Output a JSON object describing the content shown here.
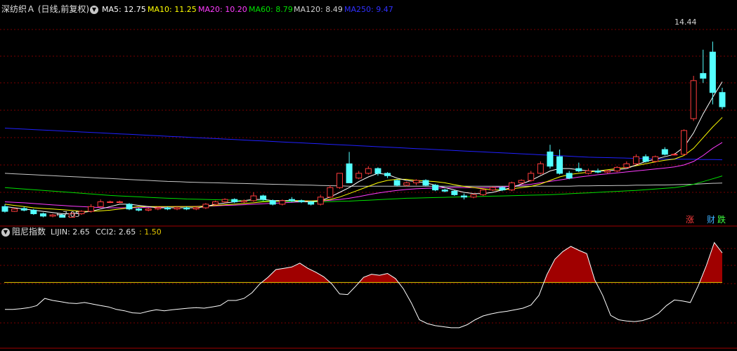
{
  "main_panel": {
    "stock_name": "深纺织Ａ",
    "period_mode": "(日线,前复权)",
    "ma5_label": "MA5: 12.75",
    "ma10_label": "MA10: 11.25",
    "ma20_label": "MA20: 10.20",
    "ma60_label": "MA60: 8.79",
    "ma120_label": "MA120: 8.49",
    "ma250_label": "MA250: 9.47",
    "high_annotation": "14.44",
    "low_annotation": "7.05",
    "side_tags": [
      "涨",
      "财",
      "跌"
    ]
  },
  "sub_panel": {
    "indicator_name": "阻尼指数",
    "lijin_label": "LIJIN: 2.65",
    "cci2_label": "CCI2: 2.65",
    "extra_label": ": 1.50"
  },
  "colors": {
    "background": "#000000",
    "grid": "#7a0000",
    "up": "#ff3c3c",
    "down": "#54ffff",
    "ma5": "#ffffff",
    "ma10": "#ffff00",
    "ma20": "#ff3cff",
    "ma60": "#00e000",
    "ma120": "#c8c8c8",
    "ma250": "#2020ff",
    "fill": "#a00000",
    "threshold": "#e6c800"
  },
  "chart_data": [
    {
      "type": "candlestick",
      "title": "深纺织Ａ (日线,前复权)",
      "ylim": [
        6.8,
        15.6
      ],
      "candles": [
        [
          7.5,
          7.3,
          7.6,
          7.25
        ],
        [
          7.3,
          7.4,
          7.45,
          7.28
        ],
        [
          7.42,
          7.35,
          7.5,
          7.3
        ],
        [
          7.35,
          7.2,
          7.4,
          7.15
        ],
        [
          7.2,
          7.1,
          7.25,
          7.05
        ],
        [
          7.1,
          7.15,
          7.2,
          7.05
        ],
        [
          7.15,
          7.05,
          7.2,
          7.05
        ],
        [
          7.05,
          7.2,
          7.3,
          7.05
        ],
        [
          7.2,
          7.3,
          7.35,
          7.15
        ],
        [
          7.3,
          7.5,
          7.6,
          7.25
        ],
        [
          7.5,
          7.7,
          7.8,
          7.45
        ],
        [
          7.7,
          7.7,
          7.75,
          7.65
        ],
        [
          7.7,
          7.7,
          7.75,
          7.65
        ],
        [
          7.6,
          7.4,
          7.65,
          7.35
        ],
        [
          7.4,
          7.35,
          7.45,
          7.3
        ],
        [
          7.35,
          7.4,
          7.45,
          7.3
        ],
        [
          7.4,
          7.45,
          7.5,
          7.35
        ],
        [
          7.45,
          7.4,
          7.5,
          7.35
        ],
        [
          7.4,
          7.45,
          7.5,
          7.35
        ],
        [
          7.45,
          7.4,
          7.5,
          7.35
        ],
        [
          7.4,
          7.45,
          7.5,
          7.35
        ],
        [
          7.45,
          7.6,
          7.65,
          7.4
        ],
        [
          7.6,
          7.7,
          7.75,
          7.55
        ],
        [
          7.7,
          7.8,
          7.85,
          7.65
        ],
        [
          7.8,
          7.7,
          7.85,
          7.65
        ],
        [
          7.7,
          7.75,
          7.8,
          7.65
        ],
        [
          7.75,
          7.95,
          8.1,
          7.7
        ],
        [
          7.95,
          7.8,
          8.0,
          7.75
        ],
        [
          7.75,
          7.6,
          7.8,
          7.55
        ],
        [
          7.6,
          7.75,
          7.8,
          7.55
        ],
        [
          7.8,
          7.75,
          7.9,
          7.7
        ],
        [
          7.75,
          7.7,
          7.8,
          7.65
        ],
        [
          7.7,
          7.6,
          7.75,
          7.55
        ],
        [
          7.6,
          7.9,
          8.0,
          7.55
        ],
        [
          7.9,
          8.3,
          8.4,
          7.85
        ],
        [
          8.3,
          8.9,
          8.9,
          8.25
        ],
        [
          9.3,
          8.5,
          9.8,
          8.5
        ],
        [
          8.7,
          8.9,
          9.0,
          8.65
        ],
        [
          8.9,
          9.1,
          9.2,
          8.85
        ],
        [
          9.1,
          8.9,
          9.15,
          8.8
        ],
        [
          8.9,
          8.8,
          8.95,
          8.7
        ],
        [
          8.6,
          8.4,
          8.65,
          8.35
        ],
        [
          8.4,
          8.5,
          8.55,
          8.35
        ],
        [
          8.5,
          8.6,
          8.65,
          8.4
        ],
        [
          8.6,
          8.4,
          8.65,
          8.35
        ],
        [
          8.4,
          8.2,
          8.45,
          8.15
        ],
        [
          8.2,
          8.15,
          8.25,
          8.1
        ],
        [
          8.15,
          8.0,
          8.2,
          7.95
        ],
        [
          7.95,
          7.9,
          8.05,
          7.8
        ],
        [
          7.9,
          8.0,
          8.05,
          7.85
        ],
        [
          8.0,
          8.2,
          8.25,
          7.95
        ],
        [
          8.2,
          8.3,
          8.35,
          8.15
        ],
        [
          8.3,
          8.2,
          8.35,
          8.15
        ],
        [
          8.2,
          8.5,
          8.55,
          8.15
        ],
        [
          8.5,
          8.6,
          8.65,
          8.45
        ],
        [
          8.6,
          8.9,
          9.0,
          8.55
        ],
        [
          8.9,
          9.3,
          9.4,
          8.85
        ],
        [
          9.8,
          9.2,
          10.1,
          9.1
        ],
        [
          9.6,
          8.9,
          9.9,
          8.85
        ],
        [
          8.9,
          8.7,
          9.0,
          8.65
        ],
        [
          9.1,
          9.0,
          9.35,
          8.95
        ],
        [
          8.9,
          9.0,
          9.1,
          8.85
        ],
        [
          9.0,
          8.95,
          9.1,
          8.9
        ],
        [
          8.95,
          9.0,
          9.05,
          8.9
        ],
        [
          9.0,
          9.15,
          9.2,
          8.95
        ],
        [
          9.15,
          9.3,
          9.4,
          9.1
        ],
        [
          9.3,
          9.6,
          9.7,
          9.25
        ],
        [
          9.6,
          9.4,
          9.7,
          9.35
        ],
        [
          9.4,
          9.6,
          9.65,
          9.35
        ],
        [
          9.9,
          9.7,
          10.0,
          9.65
        ],
        [
          9.7,
          9.7,
          9.75,
          9.65
        ],
        [
          9.7,
          10.7,
          10.75,
          9.65
        ],
        [
          11.2,
          12.8,
          13.0,
          11.1
        ],
        [
          13.1,
          12.9,
          14.1,
          12.7
        ],
        [
          14.0,
          12.3,
          14.44,
          11.8
        ],
        [
          12.3,
          11.7,
          12.5,
          11.6
        ]
      ],
      "ma": {
        "MA5": [
          7.5,
          7.45,
          7.4,
          7.35,
          7.3,
          7.25,
          7.2,
          7.2,
          7.25,
          7.3,
          7.4,
          7.5,
          7.6,
          7.6,
          7.55,
          7.5,
          7.45,
          7.45,
          7.45,
          7.45,
          7.45,
          7.5,
          7.6,
          7.65,
          7.7,
          7.75,
          7.8,
          7.8,
          7.75,
          7.75,
          7.75,
          7.7,
          7.7,
          7.75,
          7.9,
          8.1,
          8.3,
          8.55,
          8.75,
          8.9,
          8.85,
          8.7,
          8.6,
          8.55,
          8.5,
          8.4,
          8.3,
          8.2,
          8.1,
          8.05,
          8.05,
          8.1,
          8.2,
          8.3,
          8.45,
          8.6,
          8.8,
          9.0,
          9.1,
          9.1,
          9.05,
          9.0,
          9.0,
          9.0,
          9.05,
          9.1,
          9.25,
          9.4,
          9.5,
          9.6,
          9.7,
          10.0,
          10.6,
          11.4,
          12.1,
          12.75
        ],
        "MA10": [
          7.6,
          7.55,
          7.5,
          7.45,
          7.42,
          7.4,
          7.37,
          7.34,
          7.3,
          7.3,
          7.32,
          7.35,
          7.4,
          7.45,
          7.5,
          7.5,
          7.5,
          7.5,
          7.5,
          7.5,
          7.5,
          7.52,
          7.55,
          7.58,
          7.6,
          7.63,
          7.66,
          7.7,
          7.72,
          7.74,
          7.75,
          7.75,
          7.74,
          7.75,
          7.8,
          7.9,
          8.05,
          8.2,
          8.35,
          8.5,
          8.6,
          8.65,
          8.65,
          8.6,
          8.58,
          8.55,
          8.5,
          8.42,
          8.35,
          8.3,
          8.25,
          8.2,
          8.2,
          8.25,
          8.3,
          8.35,
          8.45,
          8.6,
          8.75,
          8.85,
          8.9,
          8.95,
          9.0,
          9.05,
          9.1,
          9.15,
          9.22,
          9.3,
          9.38,
          9.45,
          9.5,
          9.65,
          9.95,
          10.4,
          10.85,
          11.25
        ],
        "MA20": [
          7.7,
          7.68,
          7.66,
          7.63,
          7.6,
          7.57,
          7.55,
          7.52,
          7.5,
          7.48,
          7.46,
          7.45,
          7.45,
          7.45,
          7.46,
          7.47,
          7.48,
          7.49,
          7.5,
          7.5,
          7.51,
          7.52,
          7.53,
          7.55,
          7.56,
          7.58,
          7.6,
          7.62,
          7.64,
          7.66,
          7.68,
          7.7,
          7.72,
          7.74,
          7.77,
          7.8,
          7.85,
          7.92,
          8.0,
          8.07,
          8.13,
          8.18,
          8.22,
          8.25,
          8.27,
          8.28,
          8.29,
          8.3,
          8.3,
          8.3,
          8.3,
          8.31,
          8.33,
          8.36,
          8.4,
          8.44,
          8.5,
          8.56,
          8.62,
          8.68,
          8.74,
          8.79,
          8.84,
          8.88,
          8.92,
          8.96,
          9.0,
          9.04,
          9.08,
          9.12,
          9.17,
          9.25,
          9.4,
          9.65,
          9.95,
          10.2
        ],
        "MA60": [
          8.3,
          8.27,
          8.24,
          8.21,
          8.18,
          8.15,
          8.12,
          8.09,
          8.06,
          8.03,
          8.0,
          7.97,
          7.95,
          7.93,
          7.91,
          7.89,
          7.87,
          7.85,
          7.84,
          7.82,
          7.81,
          7.8,
          7.79,
          7.78,
          7.77,
          7.76,
          7.75,
          7.74,
          7.73,
          7.72,
          7.71,
          7.7,
          7.7,
          7.7,
          7.71,
          7.72,
          7.73,
          7.75,
          7.77,
          7.79,
          7.81,
          7.83,
          7.85,
          7.86,
          7.87,
          7.88,
          7.89,
          7.9,
          7.91,
          7.92,
          7.93,
          7.94,
          7.95,
          7.96,
          7.97,
          7.98,
          7.99,
          8.0,
          8.02,
          8.04,
          8.06,
          8.08,
          8.1,
          8.12,
          8.14,
          8.16,
          8.18,
          8.21,
          8.24,
          8.27,
          8.3,
          8.36,
          8.44,
          8.55,
          8.67,
          8.79
        ],
        "MA120": [
          8.9,
          8.88,
          8.86,
          8.84,
          8.82,
          8.8,
          8.78,
          8.76,
          8.74,
          8.72,
          8.7,
          8.68,
          8.66,
          8.64,
          8.62,
          8.6,
          8.58,
          8.56,
          8.55,
          8.53,
          8.52,
          8.51,
          8.5,
          8.49,
          8.48,
          8.47,
          8.46,
          8.45,
          8.44,
          8.43,
          8.42,
          8.41,
          8.4,
          8.39,
          8.38,
          8.37,
          8.36,
          8.36,
          8.36,
          8.36,
          8.36,
          8.36,
          8.36,
          8.36,
          8.36,
          8.36,
          8.36,
          8.36,
          8.36,
          8.36,
          8.36,
          8.36,
          8.36,
          8.36,
          8.36,
          8.36,
          8.36,
          8.36,
          8.36,
          8.36,
          8.37,
          8.37,
          8.38,
          8.38,
          8.39,
          8.39,
          8.4,
          8.4,
          8.41,
          8.41,
          8.42,
          8.43,
          8.44,
          8.46,
          8.48,
          8.49
        ],
        "MA250": [
          10.8,
          10.78,
          10.76,
          10.74,
          10.72,
          10.7,
          10.68,
          10.66,
          10.64,
          10.62,
          10.6,
          10.58,
          10.56,
          10.54,
          10.52,
          10.5,
          10.48,
          10.46,
          10.44,
          10.42,
          10.4,
          10.38,
          10.36,
          10.34,
          10.32,
          10.3,
          10.28,
          10.26,
          10.24,
          10.22,
          10.2,
          10.18,
          10.16,
          10.14,
          10.12,
          10.1,
          10.08,
          10.06,
          10.04,
          10.02,
          10.0,
          9.98,
          9.96,
          9.94,
          9.92,
          9.9,
          9.88,
          9.86,
          9.84,
          9.82,
          9.8,
          9.78,
          9.76,
          9.74,
          9.72,
          9.7,
          9.68,
          9.66,
          9.64,
          9.62,
          9.6,
          9.58,
          9.57,
          9.56,
          9.55,
          9.54,
          9.53,
          9.52,
          9.51,
          9.5,
          9.5,
          9.49,
          9.49,
          9.48,
          9.48,
          9.47
        ]
      }
    },
    {
      "type": "area",
      "title": "阻尼指数",
      "ylim": [
        -1.0,
        3.2
      ],
      "threshold": 1.5,
      "values": [
        0.45,
        0.45,
        0.48,
        0.52,
        0.6,
        0.88,
        0.8,
        0.75,
        0.7,
        0.68,
        0.72,
        0.66,
        0.6,
        0.55,
        0.45,
        0.4,
        0.32,
        0.3,
        0.38,
        0.44,
        0.4,
        0.44,
        0.47,
        0.5,
        0.52,
        0.5,
        0.55,
        0.6,
        0.8,
        0.8,
        0.88,
        1.1,
        1.45,
        1.7,
        2.0,
        2.05,
        2.1,
        2.25,
        2.05,
        1.9,
        1.72,
        1.45,
        1.05,
        1.03,
        1.35,
        1.7,
        1.82,
        1.78,
        1.85,
        1.65,
        1.25,
        0.7,
        0.05,
        -0.1,
        -0.18,
        -0.22,
        -0.26,
        -0.26,
        -0.14,
        0.05,
        0.2,
        0.28,
        0.34,
        0.38,
        0.44,
        0.5,
        0.62,
        1.0,
        1.8,
        2.4,
        2.7,
        2.9,
        2.75,
        2.62,
        1.6,
        1.0,
        0.22,
        0.05,
        0.0,
        -0.02,
        0.02,
        0.12,
        0.3,
        0.6,
        0.82,
        0.78,
        0.72,
        1.38,
        2.15,
        3.05,
        2.65
      ]
    }
  ]
}
